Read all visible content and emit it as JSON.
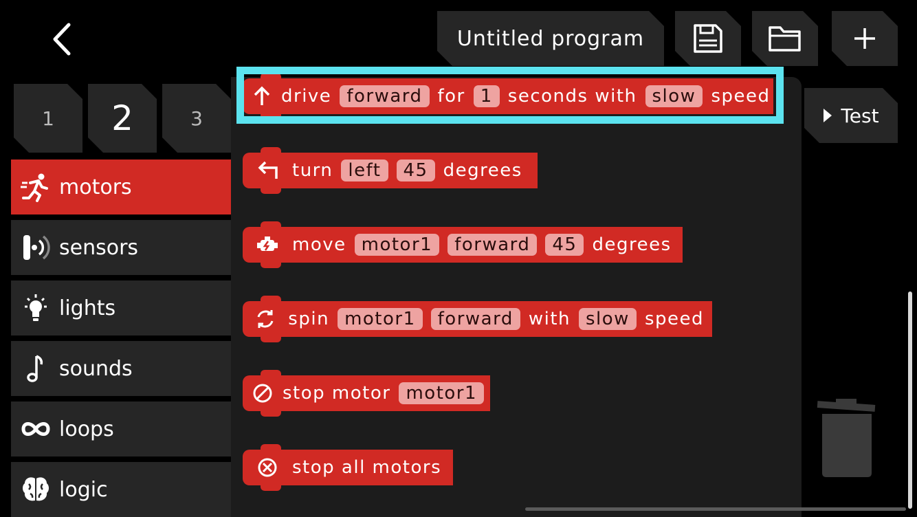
{
  "header": {
    "program_title": "Untitled program",
    "back_icon": "chevron-left-icon",
    "save_icon": "floppy-disk-icon",
    "open_icon": "folder-icon",
    "new_icon": "plus-icon"
  },
  "pages": {
    "tabs": [
      "1",
      "2",
      "3"
    ],
    "selected": "2"
  },
  "test_button": {
    "label": "Test",
    "icon": "play-icon"
  },
  "categories": [
    {
      "label": "motors",
      "icon": "running-man-icon",
      "color": "#d12a24",
      "active": true
    },
    {
      "label": "sensors",
      "icon": "sensor-icon",
      "color": "#f0b429"
    },
    {
      "label": "lights",
      "icon": "lightbulb-icon",
      "color": "#d6336c"
    },
    {
      "label": "sounds",
      "icon": "music-note-icon",
      "color": "#6a3ea1"
    },
    {
      "label": "loops",
      "icon": "infinity-icon",
      "color": "#e07b39"
    },
    {
      "label": "logic",
      "icon": "brain-icon",
      "color": "#3b6fe0"
    }
  ],
  "blocks": [
    {
      "icon": "arrow-up-icon",
      "parts": [
        "drive",
        "forward",
        "for",
        "1",
        "seconds with",
        "slow",
        "speed"
      ]
    },
    {
      "icon": "turn-left-arrow-icon",
      "parts": [
        "turn",
        "left",
        "45",
        "degrees"
      ]
    },
    {
      "icon": "motor-engine-icon",
      "parts": [
        "move",
        "motor1",
        "forward",
        "45",
        "degrees"
      ]
    },
    {
      "icon": "rotate-icon",
      "parts": [
        "spin",
        "motor1",
        "forward",
        "with",
        "slow",
        "speed"
      ]
    },
    {
      "icon": "prohibited-icon",
      "parts": [
        "stop motor",
        "motor1"
      ]
    },
    {
      "icon": "circle-x-icon",
      "parts": [
        "stop all motors"
      ]
    }
  ],
  "colors": {
    "block": "#d12a24",
    "param_bg": "#eea3a1",
    "highlight": "#5ce3ef",
    "panel": "#1c1c1c"
  }
}
